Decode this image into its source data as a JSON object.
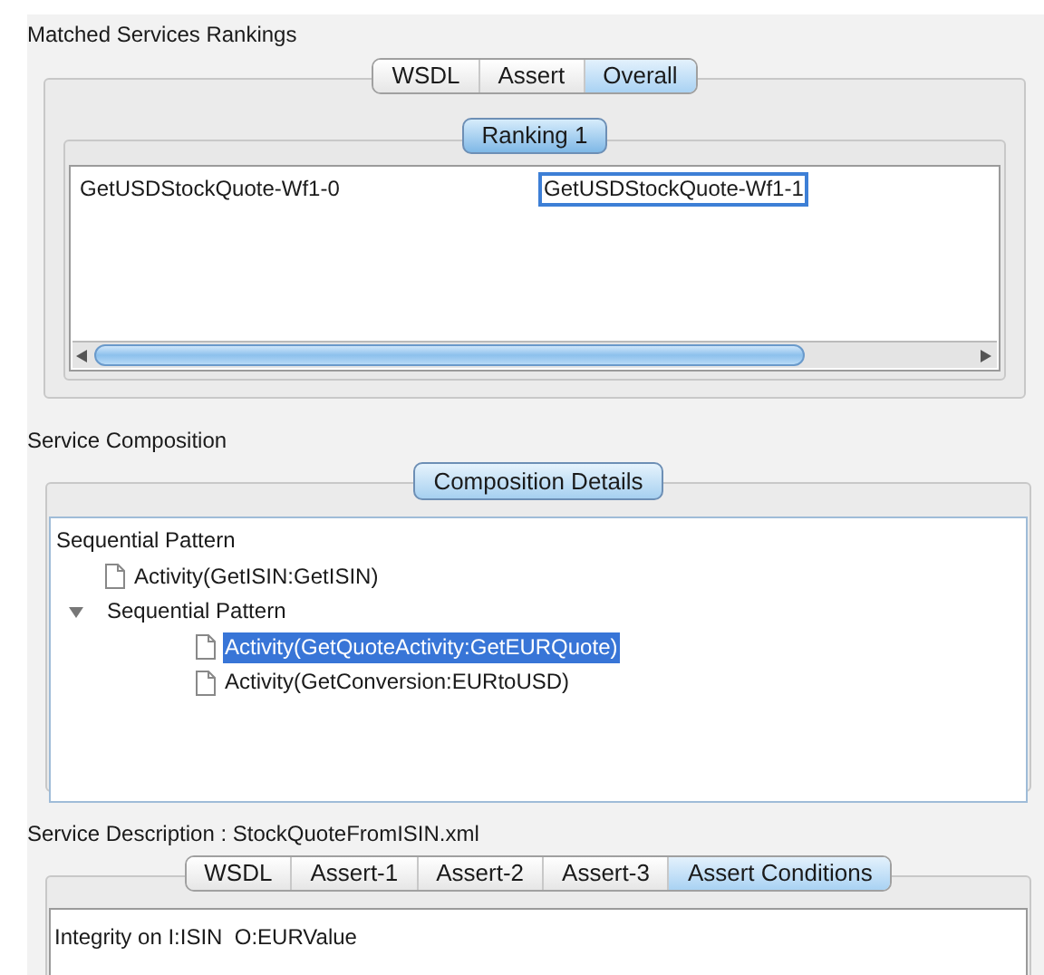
{
  "rankings": {
    "title": "Matched Services Rankings",
    "tabs": [
      {
        "label": "WSDL",
        "selected": false
      },
      {
        "label": "Assert",
        "selected": false
      },
      {
        "label": "Overall",
        "selected": true
      }
    ],
    "ranking_button": "Ranking 1",
    "cells": [
      {
        "text": "GetUSDStockQuote-Wf1-0",
        "selected": false
      },
      {
        "text": "GetUSDStockQuote-Wf1-1",
        "selected": true
      }
    ]
  },
  "composition": {
    "title": "Service Composition",
    "details_button": "Composition Details",
    "tree": [
      {
        "label": "Sequential Pattern",
        "kind": "folder",
        "selected": false,
        "children": [
          {
            "label": "Activity(GetISIN:GetISIN)",
            "kind": "leaf",
            "selected": false
          },
          {
            "label": "Sequential Pattern",
            "kind": "folder",
            "selected": false,
            "expanded": true,
            "children": [
              {
                "label": "Activity(GetQuoteActivity:GetEURQuote)",
                "kind": "leaf",
                "selected": true
              },
              {
                "label": "Activity(GetConversion:EURtoUSD)",
                "kind": "leaf",
                "selected": false
              }
            ]
          }
        ]
      }
    ]
  },
  "description": {
    "title": "Service Description : StockQuoteFromISIN.xml",
    "tabs": [
      {
        "label": "WSDL",
        "selected": false
      },
      {
        "label": "Assert-1",
        "selected": false
      },
      {
        "label": "Assert-2",
        "selected": false
      },
      {
        "label": "Assert-3",
        "selected": false
      },
      {
        "label": "Assert Conditions",
        "selected": true
      }
    ],
    "content": "Integrity on I:ISIN  O:EURValue"
  }
}
